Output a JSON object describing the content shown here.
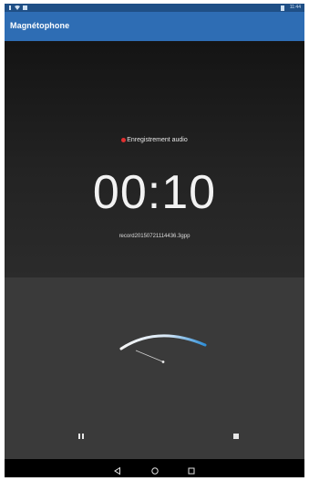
{
  "status_bar": {
    "time": "11:44",
    "icons": [
      "notification-icon",
      "wifi-icon",
      "image-icon",
      "battery-icon"
    ]
  },
  "app": {
    "title": "Magnétophone",
    "accent_color": "#2e6db4"
  },
  "recorder": {
    "state_label": "Enregistrement audio",
    "elapsed_time": "00:10",
    "file_name": "record20150721114436.3gpp"
  },
  "controls": {
    "pause": "pause-icon",
    "stop": "stop-icon"
  },
  "navigation": {
    "back": "back-icon",
    "home": "home-icon",
    "recents": "recents-icon"
  }
}
